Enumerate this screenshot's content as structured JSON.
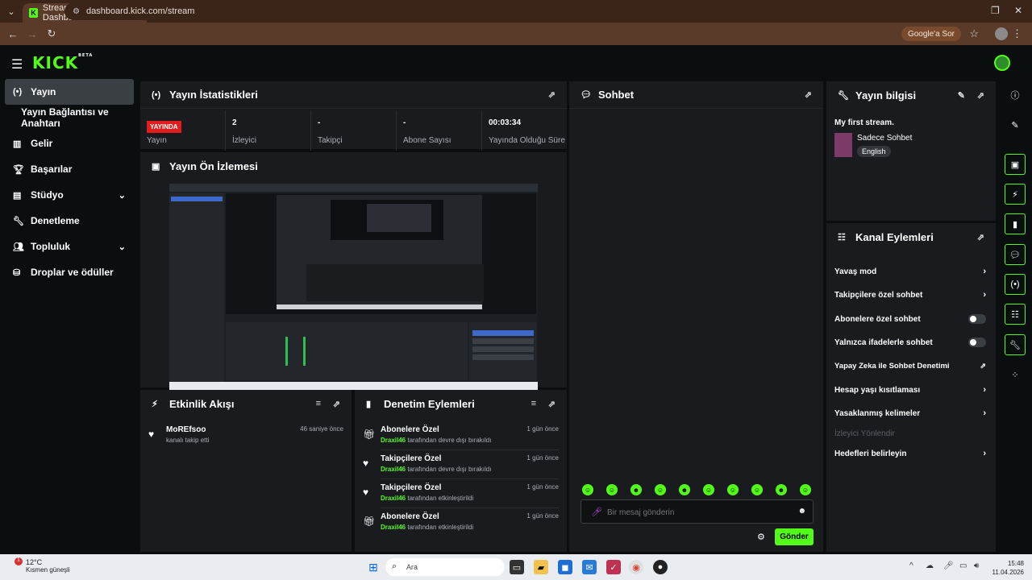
{
  "browser": {
    "tab_title": "Stream - Kick Dashboard",
    "tab_favicon": "K",
    "url": "dashboard.kick.com/stream",
    "google_btn": "Google'a Sor"
  },
  "app": {
    "logo": "KICK",
    "logo_badge": "BETA"
  },
  "sidebar": {
    "items": [
      {
        "label": "Yayın",
        "icon": "broadcast-icon"
      },
      {
        "label": "Yayın Bağlantısı ve Anahtarı"
      },
      {
        "label": "Gelir",
        "icon": "chart-icon"
      },
      {
        "label": "Başarılar",
        "icon": "trophy-icon"
      },
      {
        "label": "Stüdyo",
        "icon": "studio-icon"
      },
      {
        "label": "Denetleme",
        "icon": "wrench-icon"
      },
      {
        "label": "Topluluk",
        "icon": "community-icon"
      },
      {
        "label": "Droplar ve ödüller",
        "icon": "drops-icon"
      }
    ]
  },
  "stats_panel": {
    "title": "Yayın İstatistikleri",
    "live": "YAYINDA",
    "stats": [
      {
        "label": "Yayın",
        "value": ""
      },
      {
        "label": "İzleyici",
        "value": "2"
      },
      {
        "label": "Takipçi",
        "value": "-"
      },
      {
        "label": "Abone Sayısı",
        "value": "-"
      },
      {
        "label": "Yayında Olduğu Süre",
        "value": "00:03:34"
      }
    ]
  },
  "preview_panel": {
    "title": "Yayın Ön İzlemesi"
  },
  "activity_panel": {
    "title": "Etkinlik Akışı",
    "items": [
      {
        "user": "MoREfsoo",
        "text": "kanalı takip etti",
        "time": "46 saniye önce"
      }
    ]
  },
  "mod_panel": {
    "title": "Denetim Eylemleri",
    "items": [
      {
        "title": "Abonelere Özel",
        "user": "Draxil46",
        "text": "tarafından devre dışı bırakıldı",
        "time": "1 gün önce",
        "icon": "gift-icon"
      },
      {
        "title": "Takipçilere Özel",
        "user": "Draxil46",
        "text": "tarafından devre dışı bırakıldı",
        "time": "1 gün önce",
        "icon": "heart-icon"
      },
      {
        "title": "Takipçilere Özel",
        "user": "Draxil46",
        "text": "tarafından etkinleştirildi",
        "time": "1 gün önce",
        "icon": "heart-icon"
      },
      {
        "title": "Abonelere Özel",
        "user": "Draxil46",
        "text": "tarafından etkinleştirildi",
        "time": "1 gün önce",
        "icon": "gift-icon"
      }
    ]
  },
  "chat_panel": {
    "title": "Sohbet",
    "placeholder": "Bir mesaj gönderin",
    "send": "Gönder"
  },
  "info_panel": {
    "title": "Yayın bilgisi",
    "stream_title": "My first stream.",
    "category": "Sadece Sohbet",
    "language": "English"
  },
  "actions_panel": {
    "title": "Kanal Eylemleri",
    "items": [
      {
        "label": "Yavaş mod",
        "kind": "chevron"
      },
      {
        "label": "Takipçilere özel sohbet",
        "kind": "chevron"
      },
      {
        "label": "Abonelere özel sohbet",
        "kind": "toggle"
      },
      {
        "label": "Yalnızca ifadelerle sohbet",
        "kind": "toggle"
      },
      {
        "label": "Yapay Zeka ile Sohbet Denetimi",
        "kind": "external"
      },
      {
        "label": "Hesap yaşı kısıtlaması",
        "kind": "chevron"
      },
      {
        "label": "Yasaklanmış kelimeler",
        "kind": "chevron"
      },
      {
        "label": "İzleyici Yönlendir",
        "kind": "disabled"
      },
      {
        "label": "Hedefleri belirleyin",
        "kind": "chevron"
      }
    ]
  },
  "taskbar": {
    "temp": "12°C",
    "weather": "Kısmen güneşli",
    "search": "Ara",
    "time": "15:48",
    "date": "11.04.2026",
    "badge": "1"
  },
  "colors": {
    "accent": "#53fc18",
    "live": "#e11d1d",
    "panel": "#191b1f"
  }
}
